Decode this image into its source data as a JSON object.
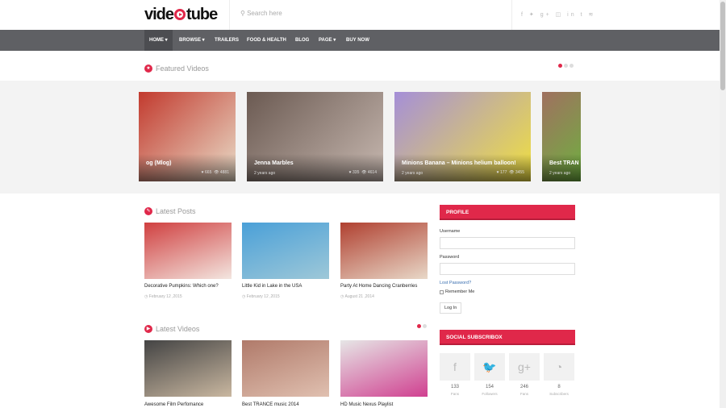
{
  "header": {
    "logo": "videotube",
    "search_placeholder": "Search here",
    "social_icons": [
      "f",
      "t",
      "g+",
      "ig",
      "in",
      "t",
      "rss"
    ]
  },
  "nav": [
    {
      "label": "HOME ▾"
    },
    {
      "label": "BROWSE ▾"
    },
    {
      "label": "TRAILERS"
    },
    {
      "label": "FOOD & HEALTH"
    },
    {
      "label": "BLOG"
    },
    {
      "label": "PAGE ▾"
    },
    {
      "label": "BUY NOW"
    }
  ],
  "featured": {
    "title": "Featured Videos",
    "cards": [
      {
        "title": "og (Mlog)",
        "age": "",
        "likes": "665",
        "views": "4881",
        "colors": [
          "#c23a2e",
          "#e9dcc8"
        ]
      },
      {
        "title": "Jenna Marbles",
        "age": "2 years ago",
        "likes": "335",
        "views": "4614",
        "colors": [
          "#6b5a52",
          "#c7b8b0"
        ]
      },
      {
        "title": "Minions Banana – Minions helium balloon!",
        "age": "2 years ago",
        "likes": "177",
        "views": "3455",
        "colors": [
          "#a58fd8",
          "#f0e040"
        ]
      },
      {
        "title": "Best TRAN",
        "age": "2 years ago",
        "likes": "",
        "views": "",
        "colors": [
          "#a07060",
          "#6fb040"
        ]
      }
    ]
  },
  "latest_posts": {
    "title": "Latest Posts",
    "items": [
      {
        "title": "Decorative Pumpkins: Which one?",
        "date": "February 12 ,2015",
        "colors": [
          "#d04040",
          "#f3e6e0"
        ]
      },
      {
        "title": "Little Kid in Lake in the USA",
        "date": "February 12 ,2015",
        "colors": [
          "#4aa0d8",
          "#9ec8d8"
        ]
      },
      {
        "title": "Party At Home Dancing Cranberries",
        "date": "August 21 ,2014",
        "colors": [
          "#b04030",
          "#e8d8c8"
        ]
      }
    ]
  },
  "latest_videos": {
    "title": "Latest Videos",
    "items": [
      {
        "title": "Awesome Film Perfomance",
        "colors": [
          "#444",
          "#c9b7a0"
        ]
      },
      {
        "title": "Best TRANCE music 2014",
        "colors": [
          "#b07a6a",
          "#e0c0b0"
        ]
      },
      {
        "title": "HD Music Nexus Playlist",
        "colors": [
          "#e6e6e6",
          "#d04090"
        ]
      }
    ]
  },
  "profile": {
    "title": "PROFILE",
    "username_label": "Username",
    "password_label": "Password",
    "lost_password": "Lost Password?",
    "remember_me": "Remember Me",
    "login": "Log In"
  },
  "social": {
    "title": "SOCIAL SUBSCRIBOX",
    "items": [
      {
        "icon": "f",
        "count": "133",
        "label": "Fans"
      },
      {
        "icon": "🐦",
        "count": "154",
        "label": "Followers"
      },
      {
        "icon": "g+",
        "count": "246",
        "label": "Fans"
      },
      {
        "icon": "◔",
        "count": "8",
        "label": "Subscribers"
      }
    ]
  }
}
